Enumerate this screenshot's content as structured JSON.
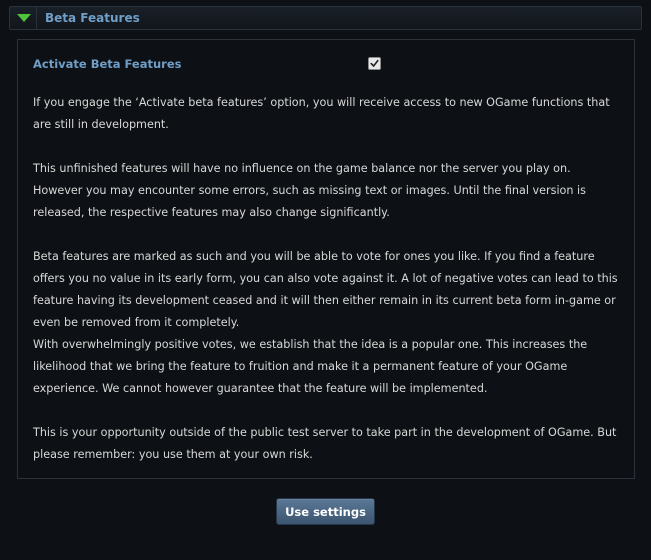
{
  "header": {
    "title": "Beta Features"
  },
  "settings": {
    "activate_label": "Activate Beta Features",
    "activate_checked": true
  },
  "content": {
    "p1": "If you engage the ‘Activate beta features’ option, you will receive access to new OGame functions that are still in development.",
    "p2": "This unfinished features will have no influence on the game balance nor the server you play on. However you may encounter some errors, such as missing text or images. Until the final version is released, the respective features may also change significantly.",
    "p3": "Beta features are marked as such and you will be able to vote for ones you like. If you find a feature offers you no value in its early form, you can also vote against it. A lot of negative votes can lead to this feature having its development ceased and it will then either remain in its current beta form in-game or even be removed from it completely.",
    "p4": "With overwhelmingly positive votes, we establish that the idea is a popular one. This increases the likelihood that we bring the feature to fruition and make it a permanent feature of your OGame experience. We cannot however guarantee that the feature will be implemented.",
    "p5": "This is your opportunity outside of the public test server to take part in the development of OGame. But please remember: you use them at your own risk."
  },
  "footer": {
    "button_label": "Use settings"
  },
  "colors": {
    "accent": "#6f9fc8",
    "toggle": "#4ec43a",
    "background": "#0d1014",
    "text": "#d8d8d8"
  }
}
